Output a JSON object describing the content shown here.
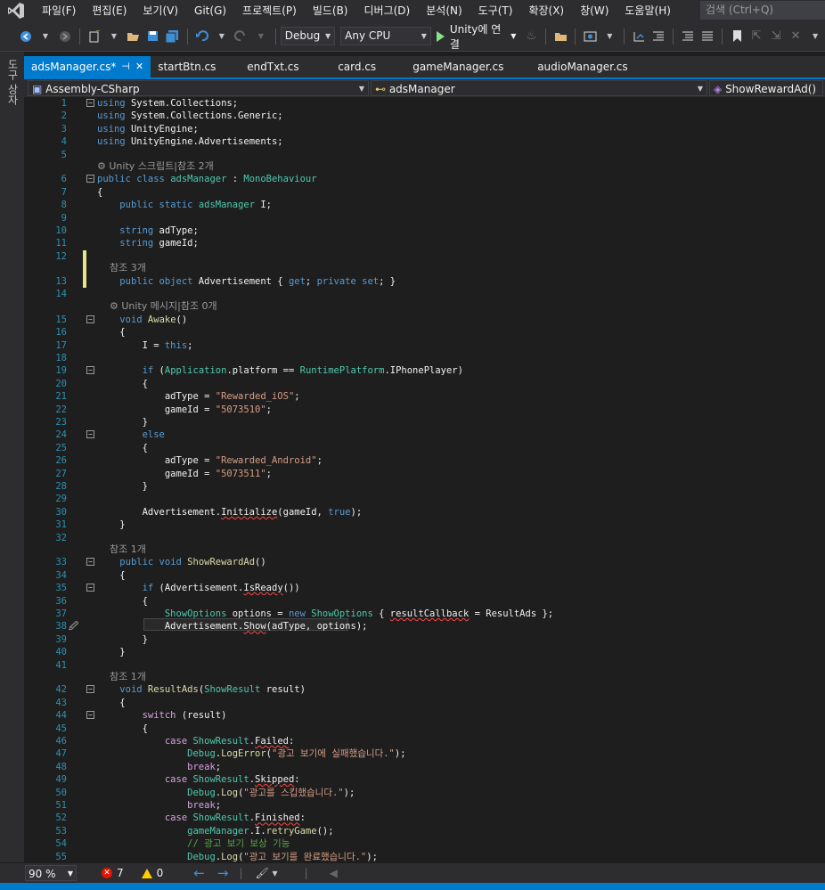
{
  "menu": [
    "파일(F)",
    "편집(E)",
    "보기(V)",
    "Git(G)",
    "프로젝트(P)",
    "빌드(B)",
    "디버그(D)",
    "분석(N)",
    "도구(T)",
    "확장(X)",
    "창(W)",
    "도움말(H)"
  ],
  "search_placeholder": "검색 (Ctrl+Q)",
  "toolbar": {
    "config": "Debug",
    "platform": "Any CPU",
    "run_label": "Unity에 연결"
  },
  "left_strip_label": "도구 상자",
  "tabs": [
    {
      "label": "adsManager.cs*",
      "active": true
    },
    {
      "label": "startBtn.cs"
    },
    {
      "label": "endTxt.cs"
    },
    {
      "label": "card.cs"
    },
    {
      "label": "gameManager.cs"
    },
    {
      "label": "audioManager.cs"
    }
  ],
  "nav": {
    "project": "Assembly-CSharp",
    "class": "adsManager",
    "member": "ShowRewardAd()"
  },
  "lens": {
    "unity_script": "Unity 스크립트|참조 2개",
    "ref3": "참조 3개",
    "unity_msg": "Unity 메시지|참조 0개",
    "ref1": "참조 1개"
  },
  "lines": {
    "l1": "System.Collections;",
    "l2": "System.Collections.Generic;",
    "l3": "UnityEngine;",
    "l4": "UnityEngine.Advertisements;",
    "ios_str": "\"Rewarded_iOS\"",
    "ios_id": "\"5073510\"",
    "and_str": "\"Rewarded_Android\"",
    "and_id": "\"5073511\"",
    "err_msg": "\"광고 보기에 실패했습니다.\"",
    "skip_msg": "\"광고를 스킵했습니다.\"",
    "comment": "// 광고 보기 보상 기능",
    "done_msg": "\"광고 보기를 완료했습니다.\""
  },
  "status": {
    "zoom": "90 %",
    "errors": "7",
    "warnings": "0"
  },
  "colors": {
    "accent": "#007acc",
    "keyword": "#569cd6",
    "type": "#4ec9b0",
    "string": "#d69d85",
    "comment": "#57a64a",
    "line_number": "#2b91af"
  }
}
